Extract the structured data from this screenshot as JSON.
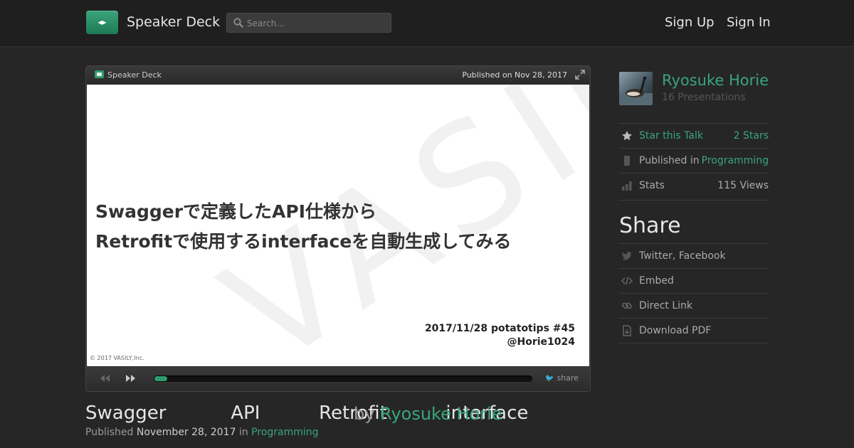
{
  "header": {
    "brand": "Speaker Deck",
    "search_placeholder": "Search...",
    "sign_up": "Sign Up",
    "sign_in": "Sign In"
  },
  "player": {
    "brand": "Speaker Deck",
    "published": "Published on Nov 28, 2017",
    "slide": {
      "title_line1": "Swaggerで定義したAPI仕様から",
      "title_line2": "Retrofitで使用するinterfaceを自動生成してみる",
      "event": "2017/11/28 potatotips #45",
      "handle": "@Horie1024",
      "copyright": "© 2017 VASILY,Inc.",
      "watermark": "VASILY"
    },
    "progress": 0.03,
    "share": "share"
  },
  "talk": {
    "title": "Swagger           API          Retrofit          interface",
    "by": "by",
    "author": "Ryosuke Horie",
    "published_label": "Published",
    "published_date": "November 28, 2017",
    "in": "in",
    "category": "Programming"
  },
  "sidebar": {
    "author_name": "Ryosuke Horie",
    "presentations": "16 Presentations",
    "star_label": "Star this Talk",
    "star_count": "2 Stars",
    "published_in_label": "Published in",
    "published_in_value": "Programming",
    "stats_label": "Stats",
    "stats_value": "115 Views",
    "share_heading": "Share",
    "share_items": [
      "Twitter, Facebook",
      "Embed",
      "Direct Link",
      "Download PDF"
    ]
  },
  "colors": {
    "accent": "#3aa57c",
    "background": "#262626"
  }
}
